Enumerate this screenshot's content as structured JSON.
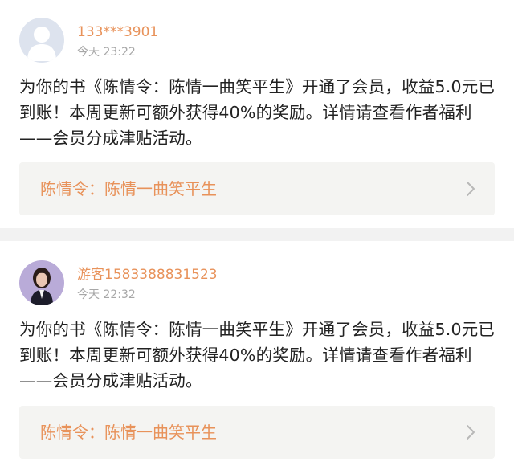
{
  "notifications": [
    {
      "username": "133***3901",
      "timestamp": "今天 23:22",
      "message": "为你的书《陈情令：陈情一曲笑平生》开通了会员，收益5.0元已到账！本周更新可额外获得40%的奖励。详情请查看作者福利——会员分成津贴活动。",
      "book_title": "陈情令：陈情一曲笑平生",
      "avatar_icon": "default-user-icon"
    },
    {
      "username": "游客1583388831523",
      "timestamp": "今天 22:32",
      "message": "为你的书《陈情令：陈情一曲笑平生》开通了会员，收益5.0元已到账！本周更新可额外获得40%的奖励。详情请查看作者福利——会员分成津贴活动。",
      "book_title": "陈情令：陈情一曲笑平生",
      "avatar_icon": "user-photo"
    }
  ],
  "colors": {
    "username": "#e8925a",
    "timestamp": "#a7a7a7",
    "link_bg": "#f4f4f2",
    "divider": "#f2f2f2"
  }
}
